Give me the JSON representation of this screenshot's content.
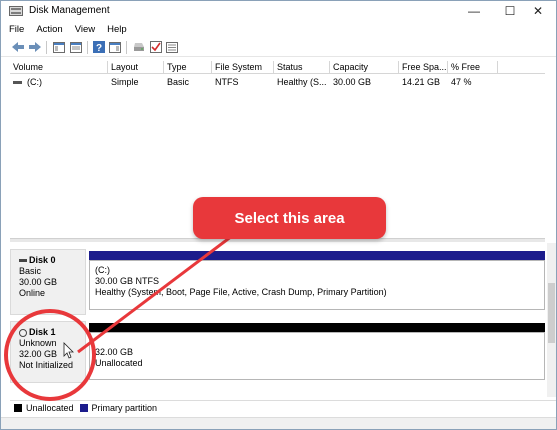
{
  "window": {
    "title": "Disk Management",
    "controls": {
      "minimize": "—",
      "maximize": "☐",
      "close": "✕"
    }
  },
  "menu": [
    "File",
    "Action",
    "View",
    "Help"
  ],
  "toolbar": {
    "icons": [
      "back-arrow-icon",
      "forward-arrow-icon",
      "console-tree-icon",
      "properties-icon",
      "help-icon",
      "action-pane-icon",
      "connect-drive-icon",
      "check-disk-icon",
      "view-icon"
    ]
  },
  "volume_list": {
    "columns": [
      "Volume",
      "Layout",
      "Type",
      "File System",
      "Status",
      "Capacity",
      "Free Spa...",
      "% Free"
    ],
    "rows": [
      {
        "volume": "(C:)",
        "layout": "Simple",
        "type": "Basic",
        "file_system": "NTFS",
        "status": "Healthy (S...",
        "capacity": "30.00 GB",
        "free_space": "14.21 GB",
        "pct_free": "47 %"
      }
    ]
  },
  "disks": [
    {
      "name": "Disk 0",
      "type": "Basic",
      "size": "30.00 GB",
      "state": "Online",
      "partition": {
        "title": "(C:)",
        "size_fs": "30.00 GB NTFS",
        "status": "Healthy (System, Boot, Page File, Active, Crash Dump, Primary Partition)"
      }
    },
    {
      "name": "Disk 1",
      "type": "Unknown",
      "size": "32.00 GB",
      "state": "Not Initialized",
      "partition": {
        "size_fs": "32.00 GB",
        "status": "Unallocated"
      }
    }
  ],
  "legend": [
    {
      "label": "Unallocated",
      "color": "#000000"
    },
    {
      "label": "Primary partition",
      "color": "#1c1c8c"
    }
  ],
  "annotation": {
    "callout": "Select this area",
    "color": "#e8383b"
  }
}
